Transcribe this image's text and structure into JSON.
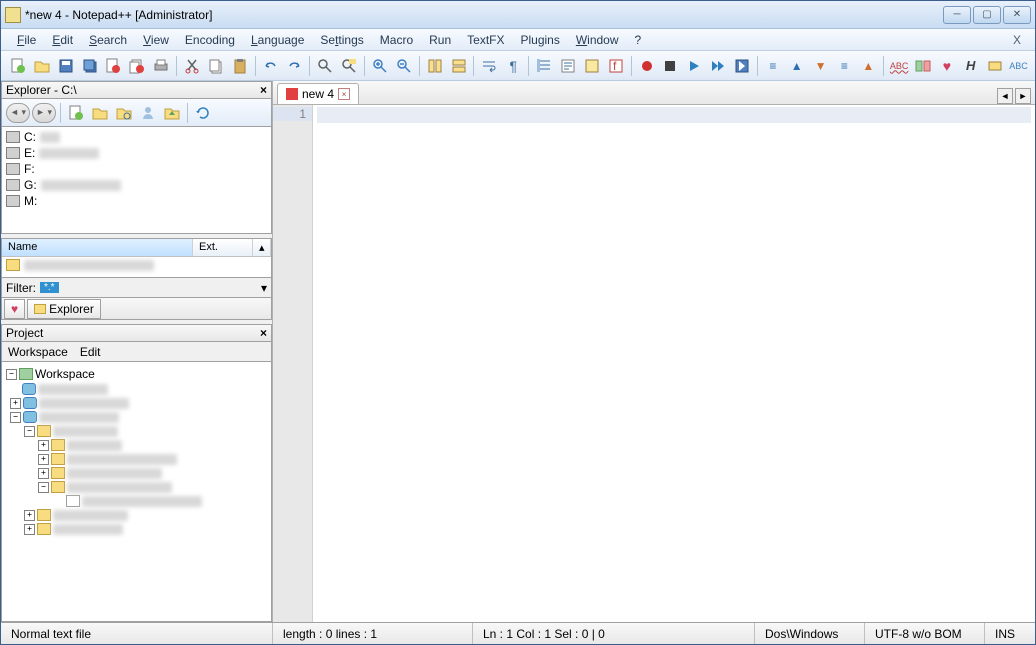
{
  "title": "*new  4 - Notepad++ [Administrator]",
  "menu": [
    "File",
    "Edit",
    "Search",
    "View",
    "Encoding",
    "Language",
    "Settings",
    "Macro",
    "Run",
    "TextFX",
    "Plugins",
    "Window",
    "?"
  ],
  "explorer": {
    "header": "Explorer - C:\\",
    "drives": [
      {
        "label": "C:",
        "redacted": true
      },
      {
        "label": "E:",
        "redacted": true
      },
      {
        "label": "F:",
        "redacted": false
      },
      {
        "label": "G:",
        "redacted": true
      },
      {
        "label": "M:",
        "redacted": false
      }
    ],
    "file_cols": {
      "name": "Name",
      "ext": "Ext."
    },
    "filter_label": "Filter:",
    "filter_value": "*.*",
    "tabs": {
      "fav": "",
      "explorer": "Explorer"
    }
  },
  "project": {
    "header": "Project",
    "menu": [
      "Workspace",
      "Edit"
    ],
    "root": "Workspace"
  },
  "editor": {
    "tab_label": "new  4",
    "line_no": "1"
  },
  "status": {
    "filetype": "Normal text file",
    "length": "length : 0    lines : 1",
    "pos": "Ln : 1    Col : 1    Sel : 0 | 0",
    "eol": "Dos\\Windows",
    "enc": "UTF-8 w/o BOM",
    "mode": "INS"
  }
}
